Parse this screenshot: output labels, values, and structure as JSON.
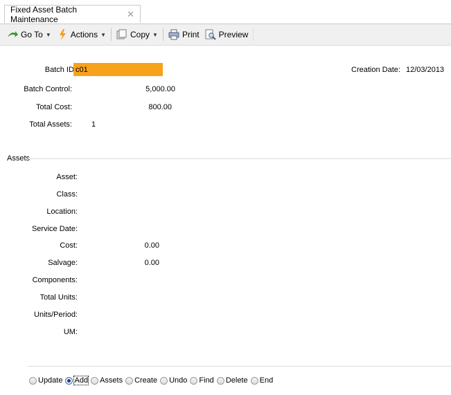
{
  "tab": {
    "title": "Fixed Asset Batch Maintenance",
    "close": "✕"
  },
  "toolbar": {
    "goto": "Go To",
    "actions": "Actions",
    "copy": "Copy",
    "print": "Print",
    "preview": "Preview"
  },
  "batch": {
    "id_label": "Batch ID:",
    "id_value": "c01",
    "creation_label": "Creation Date:",
    "creation_value": "12/03/2013",
    "control_label": "Batch Control:",
    "control_value": "5,000.00",
    "total_cost_label": "Total Cost:",
    "total_cost_value": "800.00",
    "total_assets_label": "Total Assets:",
    "total_assets_value": "1"
  },
  "assets": {
    "section_title": "Assets",
    "asset_label": "Asset:",
    "class_label": "Class:",
    "location_label": "Location:",
    "service_date_label": "Service Date:",
    "cost_label": "Cost:",
    "cost_value": "0.00",
    "salvage_label": "Salvage:",
    "salvage_value": "0.00",
    "components_label": "Components:",
    "total_units_label": "Total Units:",
    "units_period_label": "Units/Period:",
    "um_label": "UM:"
  },
  "mode": {
    "options": [
      "Update",
      "Add",
      "Assets",
      "Create",
      "Undo",
      "Find",
      "Delete",
      "End"
    ],
    "selected": "Add"
  }
}
